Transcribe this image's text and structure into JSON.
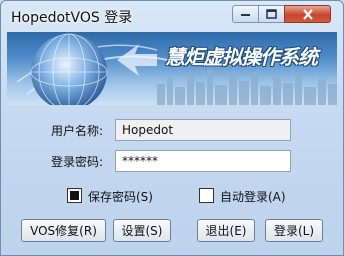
{
  "window": {
    "title": "HopedotVOS 登录",
    "controls": {
      "minimize_icon": "minimize-icon",
      "maximize_icon": "maximize-icon",
      "close_icon": "close-icon"
    }
  },
  "banner": {
    "slogan": "慧炬虚拟操作系统",
    "image": "globe-and-city-skyline"
  },
  "form": {
    "username_label": "用户名称:",
    "username_value": "Hopedot",
    "password_label": "登录密码:",
    "password_value": "******",
    "save_password_label": "保存密码(S)",
    "save_password_checked": true,
    "auto_login_label": "自动登录(A)",
    "auto_login_checked": false
  },
  "buttons": {
    "repair": "VOS修复(R)",
    "settings": "设置(S)",
    "exit": "退出(E)",
    "login": "登录(L)"
  },
  "colors": {
    "accent": "#2e6aa8",
    "close": "#c9452c"
  }
}
